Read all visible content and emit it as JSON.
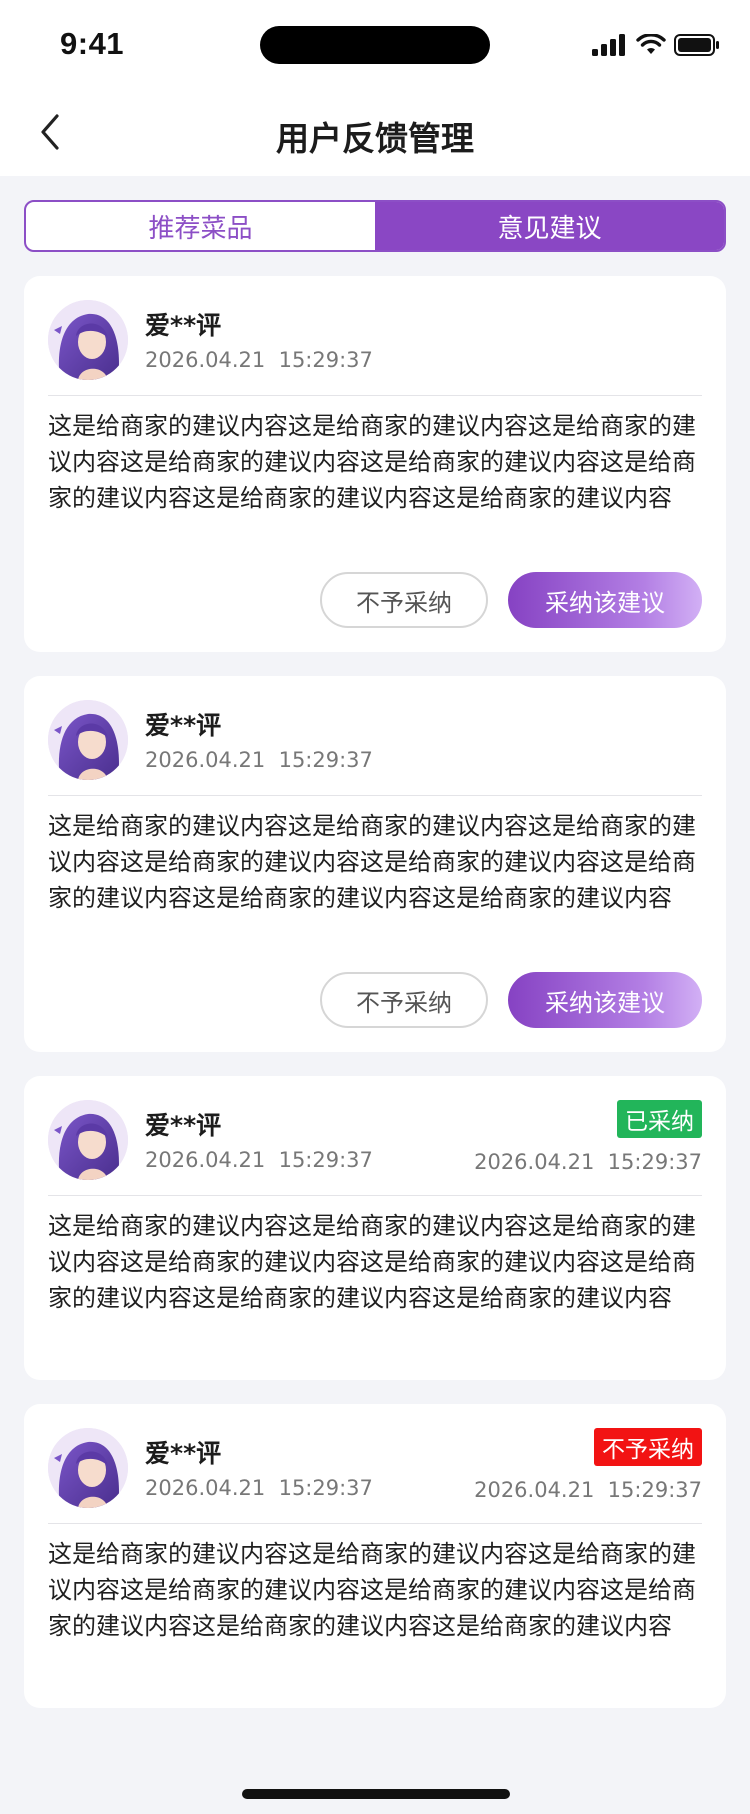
{
  "status_bar": {
    "time": "9:41"
  },
  "nav": {
    "title": "用户反馈管理"
  },
  "tabs": [
    {
      "label": "推荐菜品",
      "active": false
    },
    {
      "label": "意见建议",
      "active": true
    }
  ],
  "actions": {
    "reject_label": "不予采纳",
    "accept_label": "采纳该建议"
  },
  "feedback": [
    {
      "user": "爱**评",
      "date": "2026.04.21  15:29:37",
      "content": "这是给商家的建议内容这是给商家的建议内容这是给商家的建议内容这是给商家的建议内容这是给商家的建议内容这是给商家的建议内容这是给商家的建议内容这是给商家的建议内容"
    },
    {
      "user": "爱**评",
      "date": "2026.04.21  15:29:37",
      "content": "这是给商家的建议内容这是给商家的建议内容这是给商家的建议内容这是给商家的建议内容这是给商家的建议内容这是给商家的建议内容这是给商家的建议内容这是给商家的建议内容"
    },
    {
      "user": "爱**评",
      "date": "2026.04.21  15:29:37",
      "status": "已采纳",
      "status_color": "#22b55a",
      "status_date": "2026.04.21  15:29:37",
      "content": "这是给商家的建议内容这是给商家的建议内容这是给商家的建议内容这是给商家的建议内容这是给商家的建议内容这是给商家的建议内容这是给商家的建议内容这是给商家的建议内容"
    },
    {
      "user": "爱**评",
      "date": "2026.04.21  15:29:37",
      "status": "不予采纳",
      "status_color": "#f21313",
      "status_date": "2026.04.21  15:29:37",
      "content": "这是给商家的建议内容这是给商家的建议内容这是给商家的建议内容这是给商家的建议内容这是给商家的建议内容这是给商家的建议内容这是给商家的建议内容这是给商家的建议内容"
    }
  ],
  "colors": {
    "accent": "#8a47c4",
    "accepted": "#22b55a",
    "rejected": "#f21313"
  }
}
